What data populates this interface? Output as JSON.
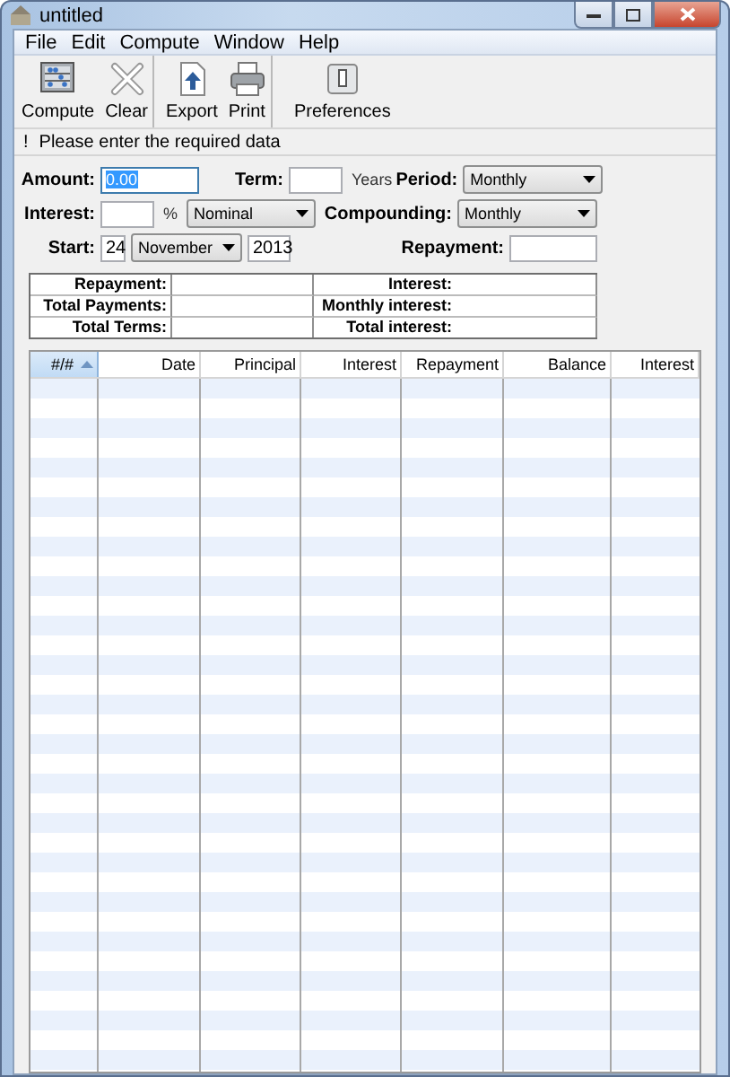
{
  "window": {
    "title": "untitled"
  },
  "menu": [
    "File",
    "Edit",
    "Compute",
    "Window",
    "Help"
  ],
  "toolbar": [
    {
      "kind": "compute",
      "label": "Compute",
      "separator_after": false
    },
    {
      "kind": "clear",
      "label": "Clear",
      "separator_after": true
    },
    {
      "kind": "export",
      "label": "Export",
      "separator_after": false
    },
    {
      "kind": "print",
      "label": "Print",
      "separator_after": true
    },
    {
      "kind": "preferences",
      "label": "Preferences",
      "separator_after": false
    }
  ],
  "notice": {
    "icon": "!",
    "text": "Please enter the required data"
  },
  "form": {
    "rows": [
      {
        "left": [
          {
            "kind": "label",
            "text": "Amount:"
          },
          {
            "kind": "field",
            "value": "0.00",
            "focused": true
          },
          {
            "kind": "label",
            "text": "Term:"
          },
          {
            "kind": "field",
            "focused": false
          },
          {
            "kind": "unit",
            "text": "Years"
          }
        ],
        "right": [
          {
            "kind": "label",
            "text": "Period:"
          },
          {
            "kind": "select",
            "value": "Monthly"
          }
        ]
      },
      {
        "left": [
          {
            "kind": "label",
            "text": "Interest:"
          },
          {
            "kind": "field",
            "focused": false
          },
          {
            "kind": "unit",
            "text": "%"
          },
          {
            "kind": "select",
            "value": "Nominal"
          }
        ],
        "right": [
          {
            "kind": "label",
            "text": "Compounding:"
          },
          {
            "kind": "select",
            "value": "Monthly"
          }
        ]
      },
      {
        "left": [
          {
            "kind": "label",
            "text": "Start:"
          },
          {
            "kind": "field",
            "value": "24",
            "focused": false
          },
          {
            "kind": "select",
            "value": "November"
          },
          {
            "kind": "field",
            "value": "2013",
            "focused": false
          }
        ],
        "right": [
          {
            "kind": "label",
            "text": "Repayment:"
          },
          {
            "kind": "field",
            "focused": false
          }
        ]
      }
    ]
  },
  "summary": {
    "items": [
      {
        "label": "Repayment:"
      },
      {
        "label": "Interest:"
      },
      {
        "label": "Total Payments:"
      },
      {
        "label": "Monthly interest:"
      },
      {
        "label": "Total Terms:"
      },
      {
        "label": "Total interest:"
      }
    ]
  },
  "table": {
    "columns": [
      {
        "label": "#/#",
        "sorted": true
      },
      {
        "label": "Date",
        "sorted": false
      },
      {
        "label": "Principal",
        "sorted": false
      },
      {
        "label": "Interest",
        "sorted": false
      },
      {
        "label": "Repayment",
        "sorted": false
      },
      {
        "label": "Balance",
        "sorted": false
      },
      {
        "label": "Interest",
        "sorted": false
      }
    ]
  }
}
